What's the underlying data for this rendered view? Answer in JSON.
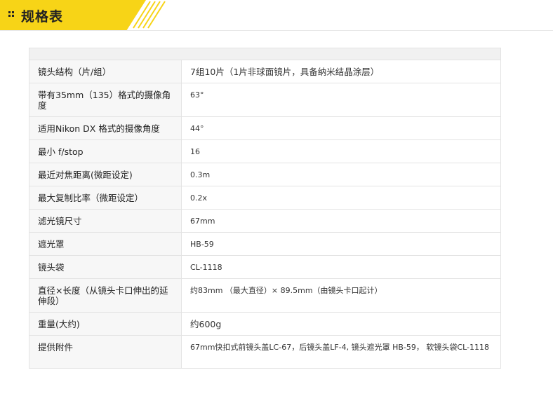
{
  "header": {
    "title": "规格表",
    "accent_color": "#f7d417"
  },
  "specs": [
    {
      "label": "镜头结构（片/组）",
      "value": "7组10片（1片非球面镜片，具备纳米结晶涂层）"
    },
    {
      "label": "带有35mm（135）格式的摄像角度",
      "value": "63°"
    },
    {
      "label": "适用Nikon DX 格式的摄像角度",
      "value": "44°"
    },
    {
      "label": "最小 f/stop",
      "value": "16"
    },
    {
      "label": "最近对焦距离(微距设定)",
      "value": "0.3m"
    },
    {
      "label": "最大复制比率（微距设定）",
      "value": "0.2x"
    },
    {
      "label": "滤光镜尺寸",
      "value": "67mm"
    },
    {
      "label": "遮光罩",
      "value": "HB-59"
    },
    {
      "label": "镜头袋",
      "value": "CL-1118"
    },
    {
      "label": "直径×长度（从镜头卡口伸出的延伸段）",
      "value": "约83mm （最大直径）× 89.5mm（由镜头卡口起计）"
    },
    {
      "label": "重量(大约)",
      "value": "约600g"
    },
    {
      "label": "提供附件",
      "value": "67mm快扣式前镜头盖LC-67，后镜头盖LF-4, 镜头遮光罩 HB-59， 软镜头袋CL-1118"
    }
  ]
}
